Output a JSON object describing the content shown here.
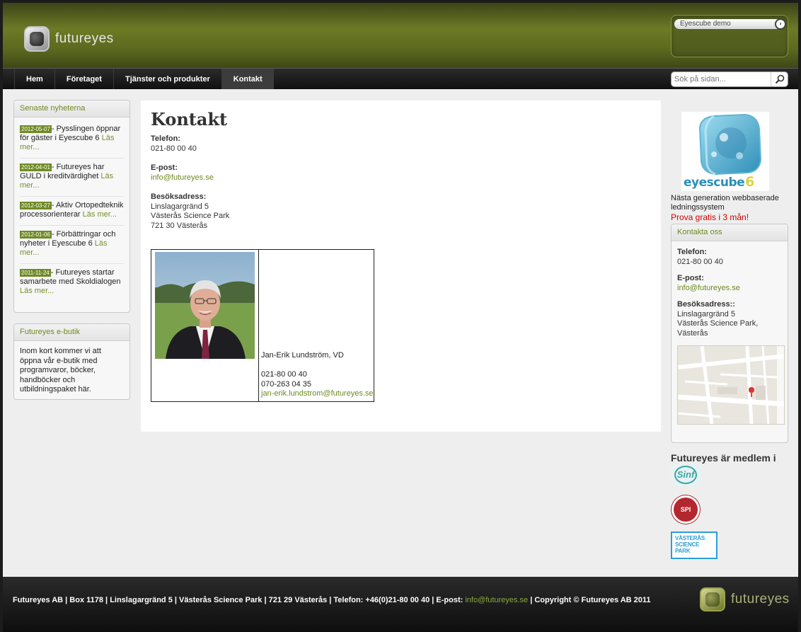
{
  "header": {
    "logo_text": "futureyes",
    "demo_select": "Eyescube demo",
    "demo_go": "›"
  },
  "nav": {
    "items": [
      "Hem",
      "Företaget",
      "Tjänster och produkter",
      "Kontakt"
    ],
    "active": "Kontakt"
  },
  "search": {
    "placeholder": "Sök på sidan..."
  },
  "left": {
    "news_title": "Senaste nyheterna",
    "news": [
      {
        "date": "2012-05-07",
        "text": "Pysslingen öppnar för gäster i Eyescube 6",
        "more": "Läs mer..."
      },
      {
        "date": "2012-04-01",
        "text": "Futureyes har GULD i kreditvärdighet",
        "more": "Läs mer..."
      },
      {
        "date": "2012-03-27",
        "text": "Aktiv Ortopedteknik processorienterar",
        "more": "Läs mer..."
      },
      {
        "date": "2012-01-06",
        "text": "Förbättringar och nyheter i Eyescube 6",
        "more": "Läs mer..."
      },
      {
        "date": "2011-11-24",
        "text": "Futureyes startar samarbete med Skoldialogen",
        "more": "Läs mer..."
      }
    ],
    "shop_title": "Futureyes e-butik",
    "shop_text": "Inom kort kommer vi att öppna vår e-butik med programvaror, böcker, handböcker och utbildningspaket här."
  },
  "main": {
    "title": "Kontakt",
    "phone_label": "Telefon:",
    "phone": "021-80 00 40",
    "email_label": "E-post:",
    "email": "info@futureyes.se",
    "address_label": "Besöksadress:",
    "address": [
      "Linslagargränd 5",
      "Västerås Science Park",
      "721 30 Västerås"
    ],
    "staff": {
      "name": "Jan-Erik Lundström, VD",
      "phone1": "021-80 00 40",
      "phone2": "070-263 04 35",
      "email": "jan-erik.lundstrom@futureyes.se"
    }
  },
  "right": {
    "eyescube_word1": "eyes",
    "eyescube_word2": "cube",
    "eyescube_version": "6",
    "eyescube_caption": "Nästa generation webbaserade ledningssystem",
    "promo": "Prova gratis i 3 mån!",
    "contact_title": "Kontakta oss",
    "phone_label": "Telefon:",
    "phone": "021-80 00 40",
    "email_label": "E-post:",
    "email": "info@futureyes.se",
    "address_label": "Besöksadress::",
    "address": [
      "Linslagargränd 5",
      "Västerås Science Park,",
      "Västerås"
    ],
    "member_title": "Futureyes är medlem i",
    "members": [
      "Sinf",
      "SPI",
      "VÄSTERÅS SCIENCE PARK"
    ]
  },
  "footer": {
    "text_before": "Futureyes AB | Box 1178 | Linslagargränd 5 | Västerås Science Park | 721 29 Västerås | Telefon: +46(0)21-80 00 40 | E-post: ",
    "email": "info@futureyes.se",
    "text_after": " | Copyright © Futureyes AB 2011",
    "logo_text": "futureyes"
  },
  "colors": {
    "accent": "#6e8a22",
    "promo": "#d40000",
    "header": "#5d6a20"
  }
}
